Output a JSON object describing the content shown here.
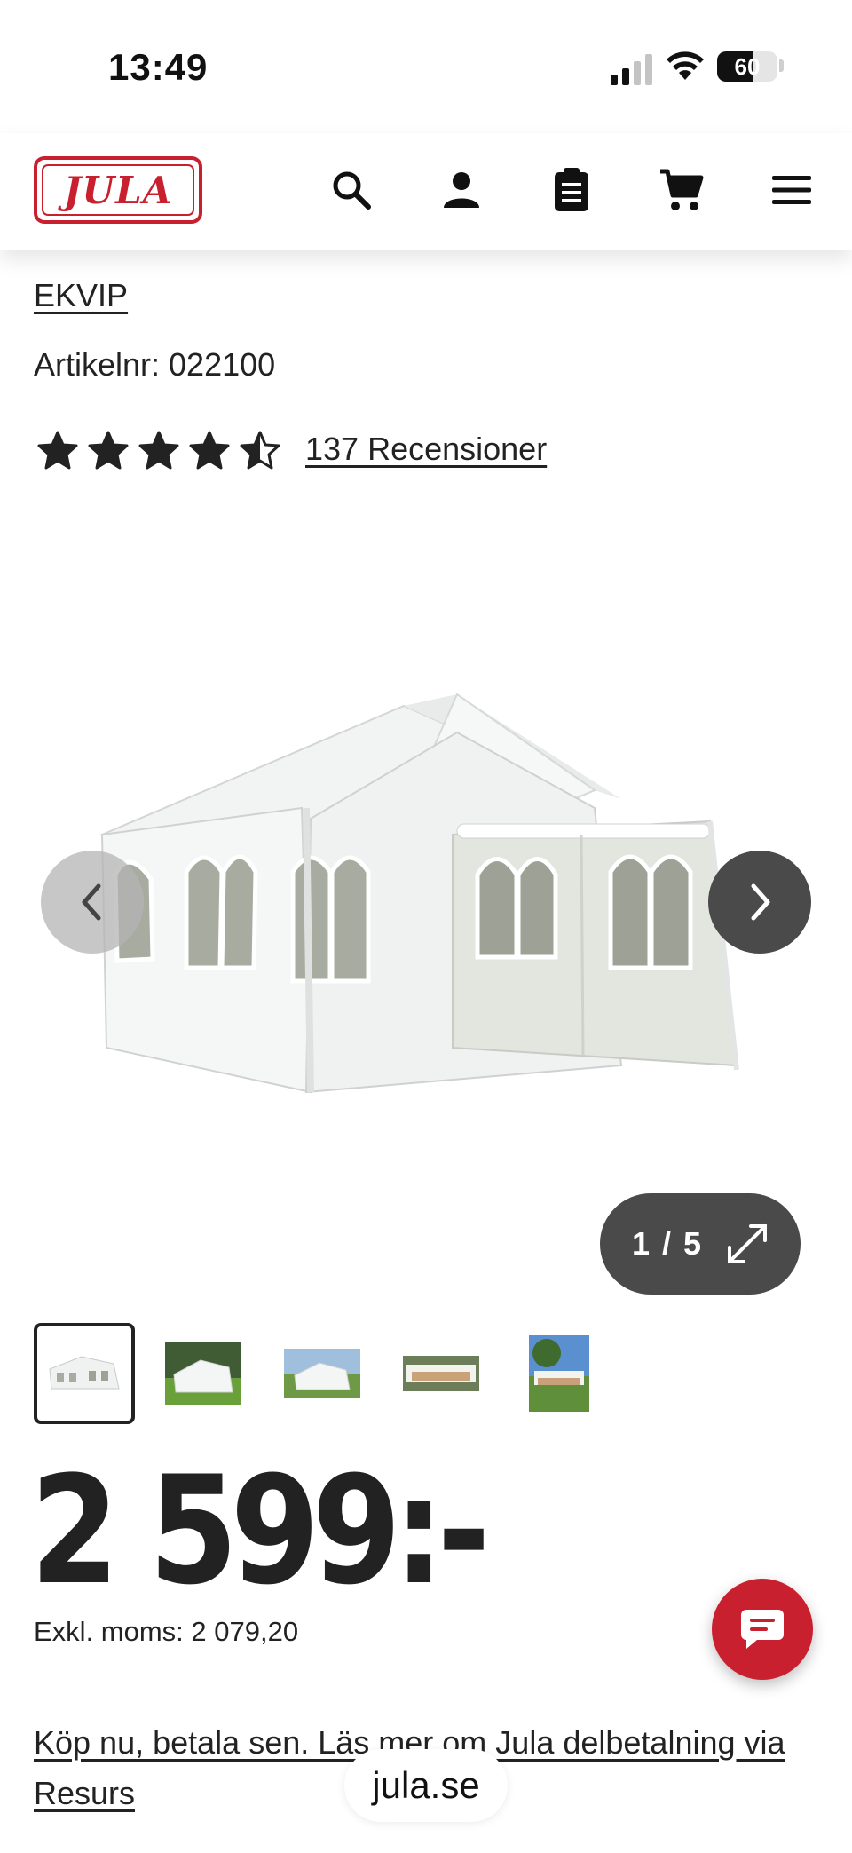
{
  "status_bar": {
    "time": "13:49",
    "battery": "60",
    "battery_level": 0.6,
    "icons": [
      "cellular-signal-icon",
      "wifi-icon",
      "battery-icon"
    ]
  },
  "header": {
    "logo_text": "JULA",
    "brand_color": "#c8202f",
    "icons": [
      "search-icon",
      "account-icon",
      "clipboard-list-icon",
      "cart-icon",
      "menu-icon"
    ]
  },
  "product": {
    "brand": "EKVIP",
    "article_number": "Artikelnr: 022100",
    "rating": 4.5,
    "rating_max": 5,
    "reviews_link": "137 Recensioner",
    "image_counter": "1 / 5",
    "thumbnails": 5,
    "selected_thumbnail": 1,
    "price": "2 599:-",
    "price_excl_vat": "Exkl. moms: 2 079,20",
    "payment_link": "Köp nu, betala sen. Läs mer om Jula delbetalning via Resurs"
  },
  "browser": {
    "url": "jula.se"
  }
}
